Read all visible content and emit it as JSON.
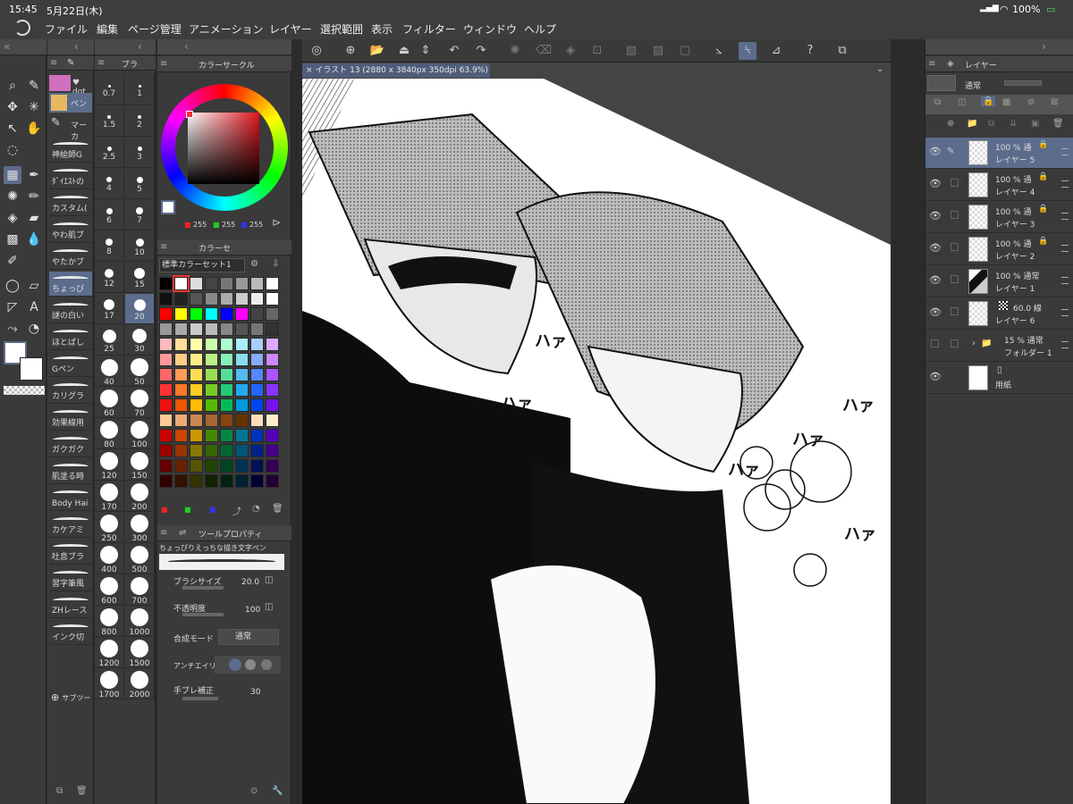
{
  "status": {
    "time": "15:45",
    "date": "5月22日(木)",
    "battery": "100%"
  },
  "menu": [
    "ファイル",
    "編集",
    "ページ管理",
    "アニメーション",
    "レイヤー",
    "選択範囲",
    "表示",
    "フィルター",
    "ウィンドウ",
    "ヘルプ"
  ],
  "subtool": {
    "tab_label": "dot",
    "items": [
      "神絵師G",
      "ﾀﾞｲｴｽﾄの",
      "カスタム(",
      "やわ肌ブ",
      "やたかブ",
      "ちょっぴ",
      "謎の白い",
      "ほとばし",
      "Gペン",
      "カリグラ",
      "効果線用",
      "ガクガク",
      "肌塗る時",
      "Body Hai",
      "カケアミ",
      "吐息ブラ",
      "習字筆風",
      "ZHレース",
      "インク切"
    ],
    "add_label": "サブツー",
    "group": {
      "top": "♥ dot",
      "pen": "ペン",
      "marker": "マーカ"
    }
  },
  "brush_tab": "ブラ",
  "brush_sizes": [
    "0.7",
    "1",
    "1.5",
    "2",
    "2.5",
    "3",
    "4",
    "5",
    "6",
    "7",
    "8",
    "10",
    "12",
    "15",
    "17",
    "20",
    "25",
    "30",
    "40",
    "50",
    "60",
    "70",
    "80",
    "100",
    "120",
    "150",
    "170",
    "200",
    "250",
    "300",
    "400",
    "500",
    "600",
    "700",
    "800",
    "1000",
    "1200",
    "1500",
    "1700",
    "2000"
  ],
  "color_circle": {
    "title": "カラーサークル",
    "r": "255",
    "g": "255",
    "b": "255"
  },
  "color_set": {
    "title": "カラーセ",
    "select": "標準カラーセット1",
    "swatches": [
      "#000000",
      "#ffffff",
      "#dddddd",
      "#444444",
      "#777777",
      "#999999",
      "#bbbbbb",
      "#ffffff",
      "#111111",
      "#222222",
      "#555555",
      "#888888",
      "#aaaaaa",
      "#cccccc",
      "#eeeeee",
      "#ffffff",
      "#ff0000",
      "#ffff00",
      "#00ff00",
      "#00ffff",
      "#0000ff",
      "#ff00ff",
      "#444444",
      "#666666",
      "#999999",
      "#aaaaaa",
      "#cccccc",
      "#bbbbbb",
      "#888888",
      "#555555",
      "#777777",
      "#333333",
      "#ffbbbb",
      "#ffdd99",
      "#ffffaa",
      "#ccffaa",
      "#aaffcc",
      "#aaeeff",
      "#aaccff",
      "#ddaaff",
      "#ff9999",
      "#ffcc88",
      "#ffee88",
      "#bbee88",
      "#88eebb",
      "#88ddee",
      "#88aaff",
      "#cc88ff",
      "#ff6666",
      "#ff9955",
      "#ffdd55",
      "#99dd55",
      "#55dd99",
      "#55bbee",
      "#5588ff",
      "#aa55ff",
      "#ff3333",
      "#ff7722",
      "#ffcc22",
      "#77cc22",
      "#22cc77",
      "#22aaee",
      "#2266ff",
      "#8833ff",
      "#ee1111",
      "#ee5500",
      "#ffbb00",
      "#55bb00",
      "#00bb55",
      "#0099dd",
      "#0044ee",
      "#7711ee",
      "#ffcc99",
      "#eeaa77",
      "#cc8855",
      "#aa6633",
      "#884411",
      "#663300",
      "#ffddbb",
      "#ffeecc",
      "#cc0000",
      "#cc4400",
      "#cc9900",
      "#448800",
      "#008844",
      "#007799",
      "#0033bb",
      "#5500bb",
      "#990000",
      "#993300",
      "#887700",
      "#336600",
      "#006633",
      "#005577",
      "#002288",
      "#440088",
      "#660000",
      "#662200",
      "#555500",
      "#224400",
      "#004422",
      "#003355",
      "#001155",
      "#330055",
      "#330000",
      "#331100",
      "#333300",
      "#112200",
      "#002211",
      "#002233",
      "#000033",
      "#220033"
    ]
  },
  "tool_property": {
    "title": "ツールプロパティ",
    "brush_name": "ちょっぴりえっちな描き文字ペン",
    "size_label": "ブラシサイズ",
    "size_value": "20.0",
    "opacity_label": "不透明度",
    "opacity_value": "100",
    "blend_label": "合成モード",
    "blend_value": "通常",
    "aa_label": "アンチエイリ",
    "stab_label": "手ブレ補正",
    "stab_value": "30"
  },
  "document_tab": "イラスト 13 (2880 x 3840px 350dpi 63.9%)",
  "canvas_text": [
    "ハァ",
    "ハァ",
    "ハァ",
    "ハァ",
    "ハァ",
    "ハァ"
  ],
  "layers": {
    "title": "レイヤー",
    "blend": "通常",
    "items": [
      {
        "line1": "100 %  通",
        "line2": "レイヤー 5",
        "selected": true
      },
      {
        "line1": "100 %  通",
        "line2": "レイヤー 4",
        "selected": false
      },
      {
        "line1": "100 %  通",
        "line2": "レイヤー 3",
        "selected": false
      },
      {
        "line1": "100 %  通",
        "line2": "レイヤー 2",
        "selected": false
      },
      {
        "line1": "100 %  通常",
        "line2": "レイヤー 1",
        "selected": false
      },
      {
        "line1": "60.0 線",
        "line2": "レイヤー 6",
        "selected": false
      },
      {
        "line1": "15 %  通常",
        "line2": "フォルダー 1",
        "selected": false
      },
      {
        "line1": "",
        "line2": "用紙",
        "selected": false
      }
    ]
  },
  "colors": {
    "accent": "#5c6c8c",
    "panel": "#3a3a3a",
    "canvas_bg": "#444444"
  }
}
